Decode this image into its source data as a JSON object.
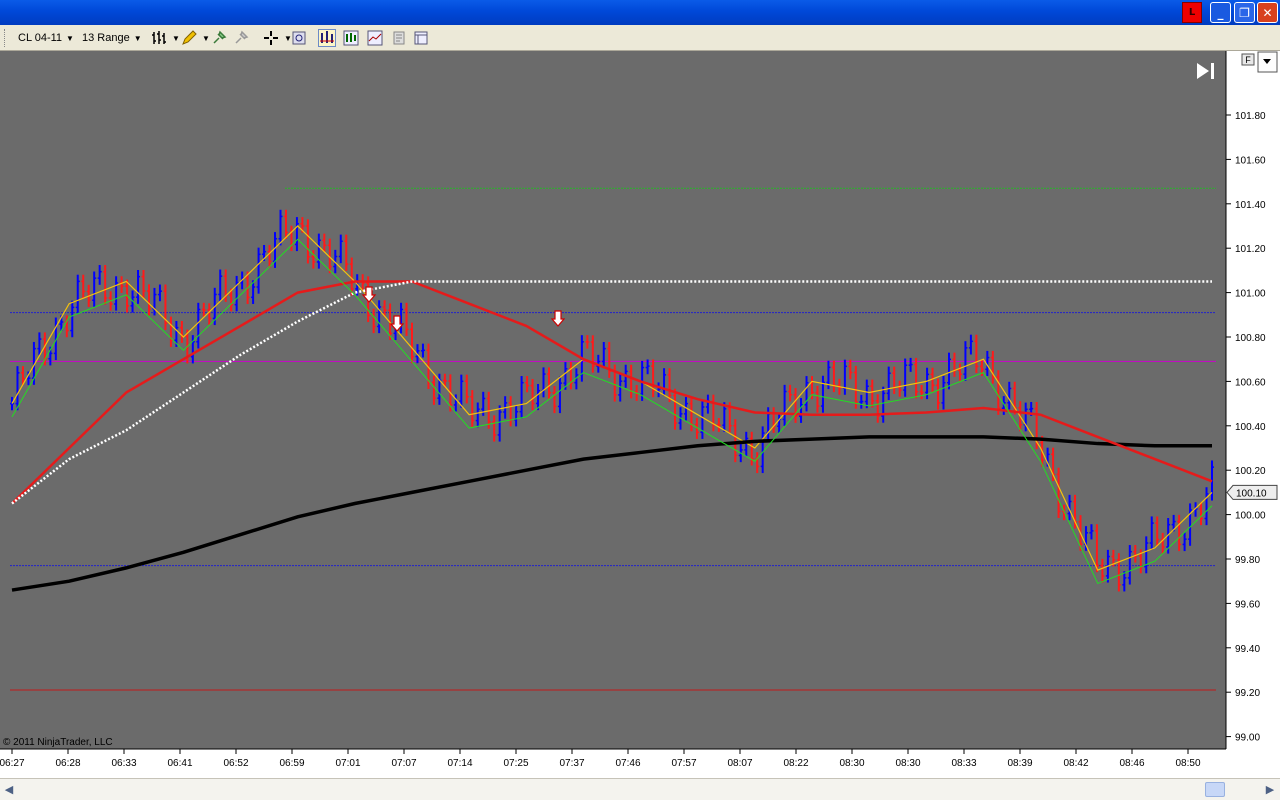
{
  "window": {
    "alert_badge": "L",
    "minimize": "_",
    "restore": "❐",
    "close": "✕"
  },
  "toolbar": {
    "instrument": "CL 04-11",
    "bar_type": "13 Range"
  },
  "chart": {
    "copyright": "© 2011 NinjaTrader, LLC",
    "last_price_label": "100.10",
    "panel_button": "F",
    "price_axis": [
      "101.80",
      "101.60",
      "101.40",
      "101.20",
      "101.00",
      "100.80",
      "100.60",
      "100.40",
      "100.20",
      "100.00",
      "99.80",
      "99.60",
      "99.40",
      "99.20",
      "99.00"
    ],
    "time_axis": [
      "06:27",
      "06:28",
      "06:33",
      "06:41",
      "06:52",
      "06:59",
      "07:01",
      "07:07",
      "07:14",
      "07:25",
      "07:37",
      "07:46",
      "07:57",
      "08:07",
      "08:22",
      "08:30",
      "08:30",
      "08:33",
      "08:39",
      "08:42",
      "08:46",
      "08:50"
    ],
    "colors": {
      "background": "#6b6b6b",
      "up_bar": "#0000ff",
      "down_bar": "#ff1a1a",
      "sma_long": "#000000",
      "ema_red": "#e51b1b",
      "ema_green": "#22dd22",
      "yellow_ma": "#f4c20d",
      "magenta_line": "#cc00cc",
      "dotted_white": "#ffffff"
    }
  },
  "chart_data": {
    "type": "line",
    "title": "",
    "xlabel": "",
    "ylabel": "",
    "ylim": [
      99.0,
      101.9
    ],
    "x": [
      "06:27",
      "06:28",
      "06:33",
      "06:41",
      "06:52",
      "06:59",
      "07:01",
      "07:07",
      "07:14",
      "07:25",
      "07:37",
      "07:46",
      "07:57",
      "08:07",
      "08:22",
      "08:30",
      "08:30",
      "08:33",
      "08:39",
      "08:42",
      "08:46",
      "08:50"
    ],
    "series": [
      {
        "values": [
          100.5,
          100.95,
          101.05,
          100.8,
          101.05,
          101.3,
          101.05,
          100.75,
          100.45,
          100.5,
          100.7,
          100.6,
          100.45,
          100.3,
          100.6,
          100.55,
          100.6,
          100.7,
          100.3,
          99.75,
          99.85,
          100.1
        ]
      },
      {
        "values": [
          99.66,
          99.7,
          99.76,
          99.83,
          99.91,
          99.99,
          100.05,
          100.1,
          100.15,
          100.2,
          100.25,
          100.28,
          100.31,
          100.33,
          100.34,
          100.35,
          100.35,
          100.35,
          100.34,
          100.32,
          100.31,
          100.31
        ]
      },
      {
        "values": [
          100.05,
          100.3,
          100.55,
          100.7,
          100.85,
          101.0,
          101.05,
          101.05,
          100.95,
          100.85,
          100.7,
          100.6,
          100.52,
          100.46,
          100.45,
          100.45,
          100.46,
          100.48,
          100.45,
          100.35,
          100.25,
          100.15
        ]
      },
      {
        "values": [
          100.05,
          100.25,
          100.38,
          100.55,
          100.72,
          100.87,
          101.0,
          101.05,
          101.05,
          101.05,
          101.05,
          101.05,
          101.05,
          101.05,
          101.05,
          101.05,
          101.05,
          101.05,
          101.05,
          101.05,
          101.05,
          101.05
        ]
      }
    ],
    "horizontal_levels": [
      101.47,
      100.91,
      100.69,
      99.77,
      99.21
    ],
    "signals": [
      {
        "x": "07:03",
        "type": "down-arrow"
      },
      {
        "x": "07:07",
        "type": "down-arrow"
      },
      {
        "x": "07:37",
        "type": "down-arrow"
      }
    ],
    "grid": false,
    "last_price": 100.1
  }
}
